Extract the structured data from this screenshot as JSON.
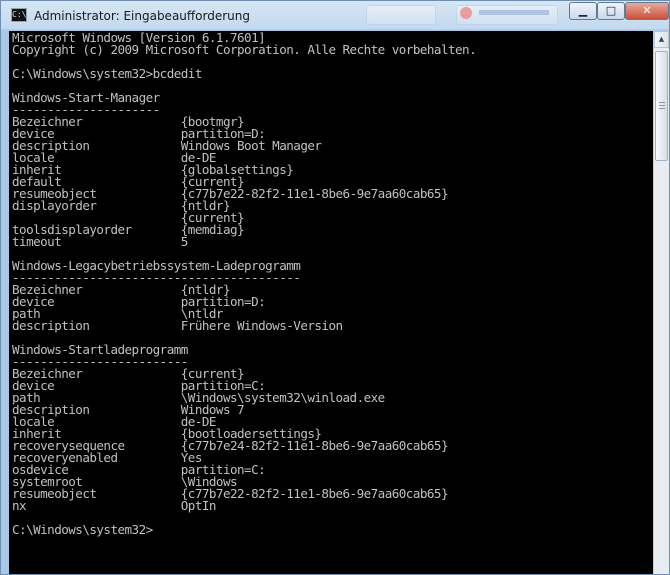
{
  "window": {
    "title": "Administrator: Eingabeaufforderung",
    "icon_text": "C:\\",
    "controls": {
      "minimize": "▁",
      "maximize": "□",
      "close": "✕"
    }
  },
  "console": {
    "lines": [
      "Microsoft Windows [Version 6.1.7601]",
      "Copyright (c) 2009 Microsoft Corporation. Alle Rechte vorbehalten.",
      "",
      "C:\\Windows\\system32>bcdedit",
      "",
      "Windows-Start-Manager",
      "---------------------",
      "Bezeichner              {bootmgr}",
      "device                  partition=D:",
      "description             Windows Boot Manager",
      "locale                  de-DE",
      "inherit                 {globalsettings}",
      "default                 {current}",
      "resumeobject            {c77b7e22-82f2-11e1-8be6-9e7aa60cab65}",
      "displayorder            {ntldr}",
      "                        {current}",
      "toolsdisplayorder       {memdiag}",
      "timeout                 5",
      "",
      "Windows-Legacybetriebssystem-Ladeprogramm",
      "-----------------------------------------",
      "Bezeichner              {ntldr}",
      "device                  partition=D:",
      "path                    \\ntldr",
      "description             Frühere Windows-Version",
      "",
      "Windows-Startladeprogramm",
      "-------------------------",
      "Bezeichner              {current}",
      "device                  partition=C:",
      "path                    \\Windows\\system32\\winload.exe",
      "description             Windows 7",
      "locale                  de-DE",
      "inherit                 {bootloadersettings}",
      "recoverysequence        {c77b7e24-82f2-11e1-8be6-9e7aa60cab65}",
      "recoveryenabled         Yes",
      "osdevice                partition=C:",
      "systemroot              \\Windows",
      "resumeobject            {c77b7e22-82f2-11e1-8be6-9e7aa60cab65}",
      "nx                      OptIn",
      "",
      "C:\\Windows\\system32>"
    ]
  },
  "scrollbar": {
    "up_arrow": "▲"
  },
  "colors": {
    "console_background": "#000000",
    "console_text": "#c0c0c0",
    "close_button": "#c8503a"
  }
}
